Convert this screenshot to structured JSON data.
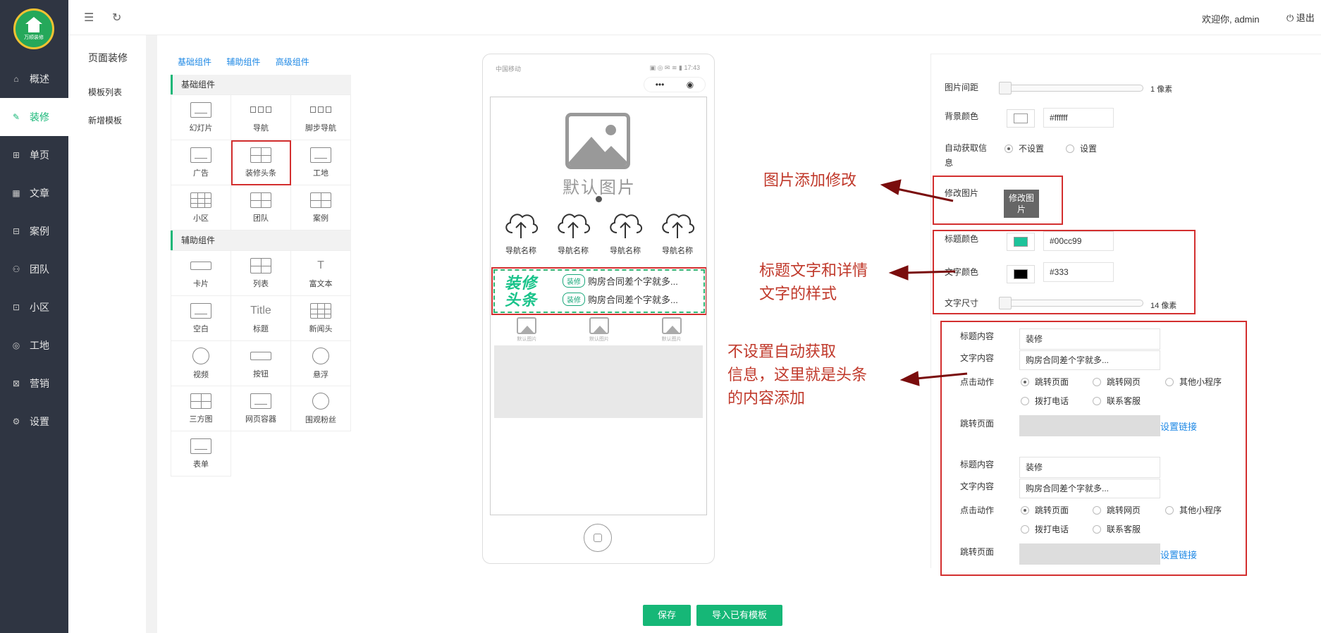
{
  "app": {
    "logo_text": "万顺装修",
    "welcome": "欢迎你, admin",
    "logout": "退出"
  },
  "sidebar": {
    "items": [
      {
        "label": "概述",
        "icon": "home-icon",
        "active": false
      },
      {
        "label": "装修",
        "icon": "brush-icon",
        "active": true
      },
      {
        "label": "单页",
        "icon": "gift-icon",
        "active": false
      },
      {
        "label": "文章",
        "icon": "grid-icon",
        "active": false
      },
      {
        "label": "案例",
        "icon": "layout-icon",
        "active": false
      },
      {
        "label": "团队",
        "icon": "user-icon",
        "active": false
      },
      {
        "label": "小区",
        "icon": "inbox-icon",
        "active": false
      },
      {
        "label": "工地",
        "icon": "location-icon",
        "active": false
      },
      {
        "label": "营销",
        "icon": "ticket-icon",
        "active": false
      },
      {
        "label": "设置",
        "icon": "gear-icon",
        "active": false
      }
    ]
  },
  "subnav": {
    "title": "页面装修",
    "items": [
      "模板列表",
      "新增模板"
    ]
  },
  "components": {
    "tabs": [
      "基础组件",
      "辅助组件",
      "高级组件"
    ],
    "basic_title": "基础组件",
    "basic": [
      "幻灯片",
      "导航",
      "脚步导航",
      "广告",
      "装修头条",
      "工地",
      "小区",
      "团队",
      "案例"
    ],
    "aux_title": "辅助组件",
    "aux": [
      "卡片",
      "列表",
      "富文本",
      "空白",
      "标题",
      "新闻头",
      "视频",
      "按钮",
      "悬浮",
      "三方图",
      "网页容器",
      "围观粉丝",
      "表单"
    ],
    "title_glyph": "Title"
  },
  "phone": {
    "carrier": "中国移动",
    "time": "17:43",
    "banner_caption": "默认图片",
    "nav_items": [
      "导航名称",
      "导航名称",
      "导航名称",
      "导航名称"
    ],
    "headline_logo_1": "装修",
    "headline_logo_2": "头条",
    "headline_rows": [
      {
        "tag": "装修",
        "text": "购房合同差个字就多..."
      },
      {
        "tag": "装修",
        "text": "购房合同差个字就多..."
      }
    ],
    "thumbs": [
      "默认图片",
      "默认图片",
      "默认图片"
    ]
  },
  "actions": {
    "save": "保存",
    "import": "导入已有模板"
  },
  "settings": {
    "img_spacing_label": "图片间距",
    "img_spacing_value": "1",
    "img_spacing_unit": "像素",
    "bg_color_label": "背景颜色",
    "bg_color_value": "#ffffff",
    "auto_info_label_1": "自动获取信",
    "auto_info_label_2": "息",
    "auto_opts": [
      "不设置",
      "设置"
    ],
    "modify_img_label": "修改图片",
    "modify_img_btn_1": "修改图",
    "modify_img_btn_2": "片",
    "title_color_label": "标题颜色",
    "title_color_value": "#00cc99",
    "text_color_label": "文字颜色",
    "text_color_value": "#333",
    "text_size_label": "文字尺寸",
    "text_size_value": "14",
    "text_size_unit": "像素",
    "colors": {
      "title": "#1dc39a",
      "text": "#000000",
      "bg": "#ffffff"
    },
    "items": [
      {
        "title_label": "标题内容",
        "title_value": "装修",
        "text_label": "文字内容",
        "text_value": "购房合同差个字就多...",
        "action_label": "点击动作",
        "actions": [
          "跳转页面",
          "跳转网页",
          "其他小程序",
          "拨打电话",
          "联系客服"
        ],
        "jump_label": "跳转页面",
        "link": "设置链接"
      },
      {
        "title_label": "标题内容",
        "title_value": "装修",
        "text_label": "文字内容",
        "text_value": "购房合同差个字就多...",
        "action_label": "点击动作",
        "actions": [
          "跳转页面",
          "跳转网页",
          "其他小程序",
          "拨打电话",
          "联系客服"
        ],
        "jump_label": "跳转页面",
        "link": "设置链接"
      }
    ]
  },
  "annotations": {
    "a1": "图片添加修改",
    "a2_1": "标题文字和详情",
    "a2_2": "文字的样式",
    "a3_1": "不设置自动获取",
    "a3_2": "信息，这里就是头条",
    "a3_3": "的内容添加"
  }
}
